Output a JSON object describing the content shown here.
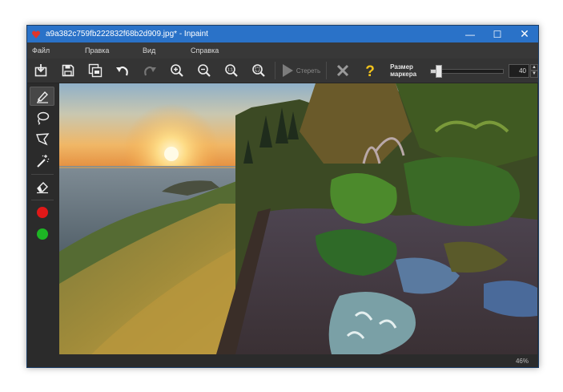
{
  "window": {
    "title": "a9a382c759fb222832f68b2d909.jpg* - Inpaint",
    "controls": {
      "minimize": "—",
      "maximize": "☐",
      "close": "✕"
    }
  },
  "menu": {
    "items": [
      "Файл",
      "Правка",
      "Вид",
      "Справка"
    ]
  },
  "toolbar": {
    "buttons": [
      "open-icon",
      "save-icon",
      "save-as-icon",
      "undo-icon",
      "redo-icon",
      "zoom-in-icon",
      "zoom-out-icon",
      "actual-size-icon",
      "fit-icon"
    ],
    "erase_label": "Стереть",
    "marker_size_label_line1": "Размер",
    "marker_size_label_line2": "маркера",
    "marker_size_value": "40",
    "marker_size_fraction": 0.08
  },
  "sidebar": {
    "tools": [
      "marker-icon",
      "lasso-icon",
      "polygon-lasso-icon",
      "magic-wand-icon",
      "eraser-icon"
    ],
    "colors": {
      "red": "#e01818",
      "green": "#1db524"
    }
  },
  "status": {
    "zoom": "46%"
  },
  "colors": {
    "titlebar": "#2a72c8",
    "window_bg": "#2b2b2b",
    "accent_yellow": "#f2c31c"
  }
}
